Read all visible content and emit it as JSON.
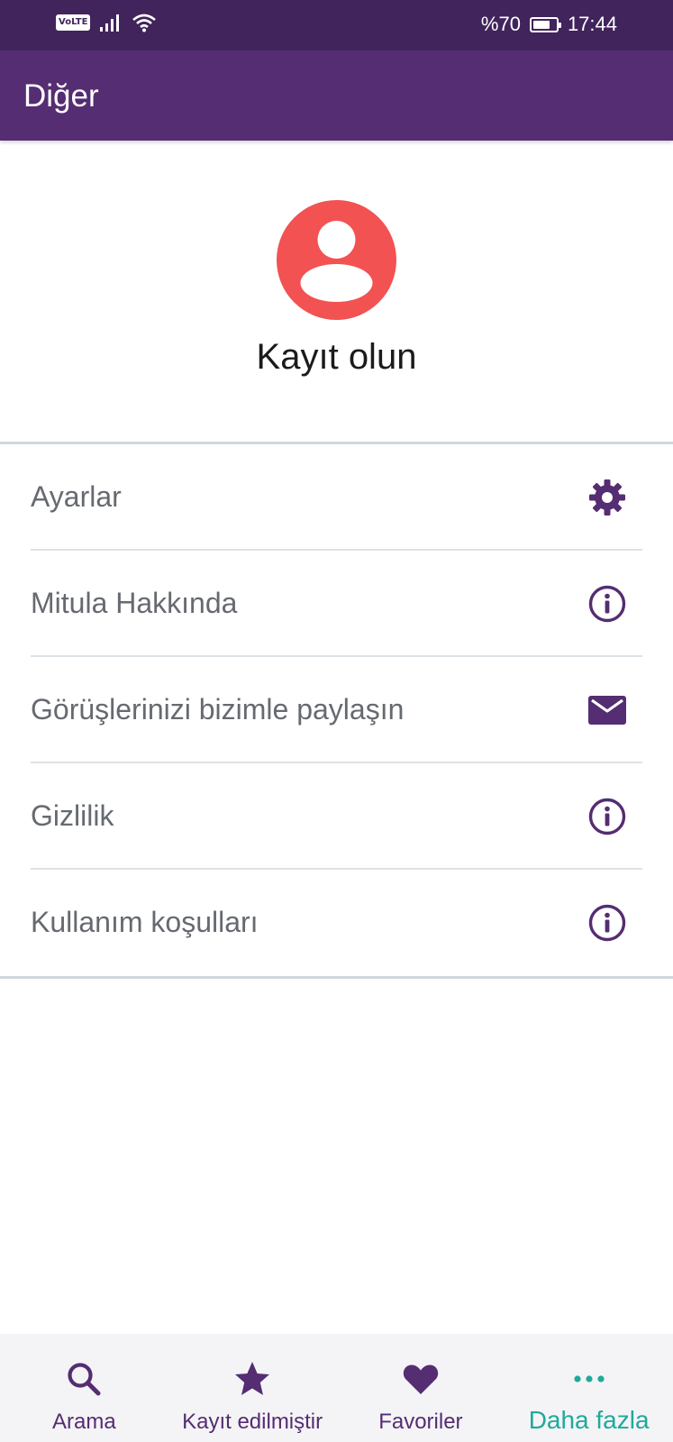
{
  "status_bar": {
    "volte": "VoLTE",
    "battery": "%70",
    "time": "17:44"
  },
  "app_bar": {
    "title": "Diğer"
  },
  "profile": {
    "register_label": "Kayıt olun"
  },
  "menu": {
    "items": [
      {
        "label": "Ayarlar",
        "icon": "gear-icon"
      },
      {
        "label": "Mitula Hakkında",
        "icon": "info-icon"
      },
      {
        "label": "Görüşlerinizi bizimle paylaşın",
        "icon": "mail-icon"
      },
      {
        "label": "Gizlilik",
        "icon": "info-icon"
      },
      {
        "label": "Kullanım koşulları",
        "icon": "info-icon"
      }
    ]
  },
  "bottom_nav": {
    "items": [
      {
        "label": "Arama",
        "icon": "search-icon"
      },
      {
        "label": "Kayıt edilmiştir",
        "icon": "star-icon"
      },
      {
        "label": "Favoriler",
        "icon": "heart-icon"
      },
      {
        "label": "Daha fazla",
        "icon": "more-dots-icon",
        "active": true
      }
    ]
  },
  "colors": {
    "status_bar": "#41245c",
    "app_bar": "#552d72",
    "accent_purple": "#552d72",
    "avatar_red": "#f25252",
    "active_teal": "#20a99b",
    "menu_text": "#666a70"
  }
}
